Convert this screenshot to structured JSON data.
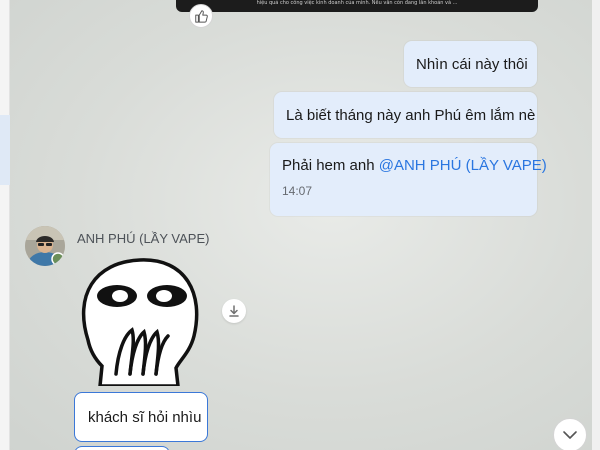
{
  "media": {
    "caption": "hiệu quả cho công việc kinh doanh của mình. Nếu vẫn còn đang lăn khoản và ..."
  },
  "messages_sent": [
    {
      "text": "Nhìn cái này thôi"
    },
    {
      "text": "Là biết tháng này anh Phú êm lắm nè"
    },
    {
      "text": "Phải hem anh ",
      "mention": "@ANH PHÚ (LẦY VAPE)",
      "time": "14:07"
    }
  ],
  "received": {
    "sender": "ANH PHÚ (LẦY VAPE)",
    "message": "khách sĩ hỏi nhìu"
  },
  "colors": {
    "sent_bubble": "#e3edfb",
    "mention": "#2a76e0",
    "received_border": "#3b78d8"
  },
  "icons": {
    "like": "thumbs-up-icon",
    "download": "download-icon",
    "scroll": "chevron-down-icon",
    "sticker": "shocked-face-sticker"
  }
}
